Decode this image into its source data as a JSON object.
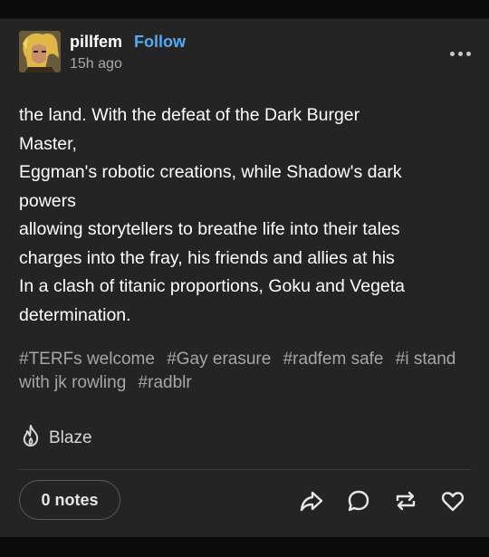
{
  "post": {
    "username": "pillfem",
    "follow_label": "Follow",
    "time": "15h ago",
    "body_lines": [
      "the land. With the defeat of the Dark Burger",
      "Master,",
      "Eggman's robotic creations, while Shadow's dark",
      "powers",
      "allowing storytellers to breathe life into their tales",
      "charges into the fray, his friends and allies at his",
      "In a clash of titanic proportions, Goku and Vegeta",
      "determination."
    ],
    "tags": [
      "#TERFs welcome",
      "#Gay erasure",
      "#radfem safe",
      "#i stand with jk rowling",
      "#radblr"
    ]
  },
  "footer": {
    "blaze_label": "Blaze",
    "notes_label": "0 notes"
  },
  "icons": {
    "more": "more-horizontal-icon",
    "blaze": "flame-icon",
    "share": "share-arrow-icon",
    "reply": "reply-bubble-icon",
    "reblog": "reblog-icon",
    "like": "heart-icon"
  },
  "colors": {
    "card_bg": "#242424",
    "page_bg": "#0b0b0b",
    "follow": "#55a9f5",
    "tag": "#a6a6a6"
  }
}
